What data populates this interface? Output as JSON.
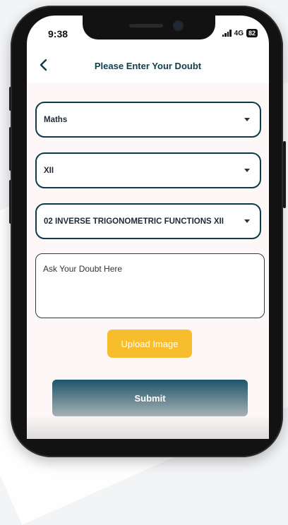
{
  "status_bar": {
    "time": "9:38",
    "network": "4G",
    "battery": "82"
  },
  "header": {
    "back_icon": "chevron-left-icon",
    "title": "Please Enter Your Doubt"
  },
  "form": {
    "subject": {
      "value": "Maths"
    },
    "class": {
      "value": "XII"
    },
    "chapter": {
      "value": "02 INVERSE TRIGONOMETRIC FUNCTIONS XII"
    },
    "doubt": {
      "placeholder": "Ask Your Doubt Here"
    },
    "upload_label": "Upload Image",
    "submit_label": "Submit"
  },
  "colors": {
    "accent": "#0d3b4c",
    "upload": "#f7bd2c",
    "submit": "#1d5469"
  }
}
